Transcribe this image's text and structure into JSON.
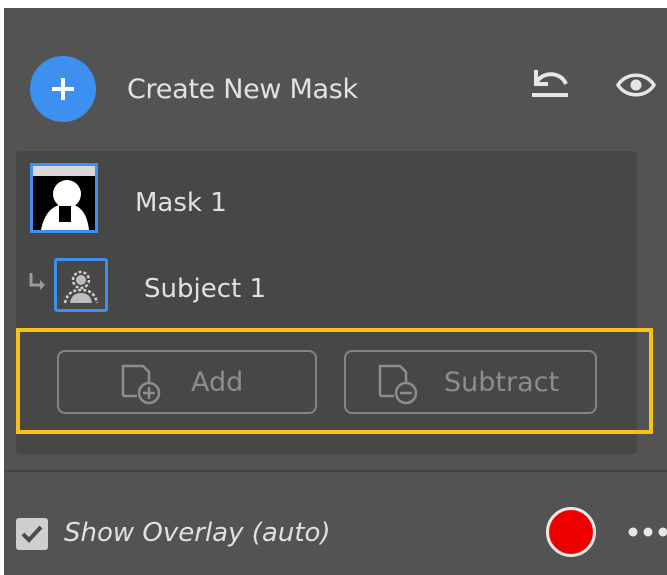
{
  "header": {
    "create_mask_label": "Create New Mask",
    "add_icon": "plus-icon",
    "reset_icon": "reset-icon",
    "visibility_icon": "eye-icon"
  },
  "masks": [
    {
      "label": "Mask 1",
      "children": [
        {
          "label": "Subject 1"
        }
      ]
    }
  ],
  "actions": {
    "add_label": "Add",
    "subtract_label": "Subtract"
  },
  "footer": {
    "show_overlay_label": "Show Overlay (auto)",
    "show_overlay_checked": true,
    "overlay_color": "#ee0000",
    "more_icon": "more-horizontal-icon"
  },
  "colors": {
    "accent": "#3d8ff0",
    "highlight": "#f6c21a",
    "panel_bg": "#535353"
  }
}
